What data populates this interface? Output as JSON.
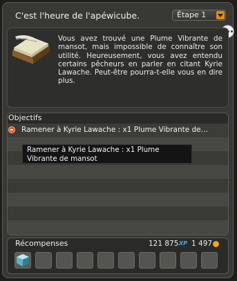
{
  "header": {
    "title": "C'est l'heure de l'apéwicube.",
    "step_label": "Étape 1"
  },
  "description": {
    "text": "Vous avez trouvé une Plume Vibrante de mansot, mais impossible de connaître son utilité. Heureusement, vous avez entendu certains pêcheurs en parler en citant Kyrie Lawache. Peut-être pourra-t-elle vous en dire plus."
  },
  "objectives": {
    "header": "Objectifs",
    "items": [
      {
        "text": "Ramener à Kyrie Lawache : x1 Plume Vibrante de…",
        "tooltip": "Ramener à Kyrie Lawache : x1 Plume Vibrante de mansot",
        "status_icon": "objective-incomplete-icon"
      }
    ]
  },
  "rewards": {
    "header": "Récompenses",
    "xp_value": "121 875",
    "xp_label": "XP",
    "kamas_value": "1 497",
    "slot_count": 10,
    "first_slot_icon": "cube-icon"
  },
  "colors": {
    "accent_orange": "#e38c12",
    "xp_blue": "#4fa7e4",
    "kama_gold": "#f0a21c"
  }
}
